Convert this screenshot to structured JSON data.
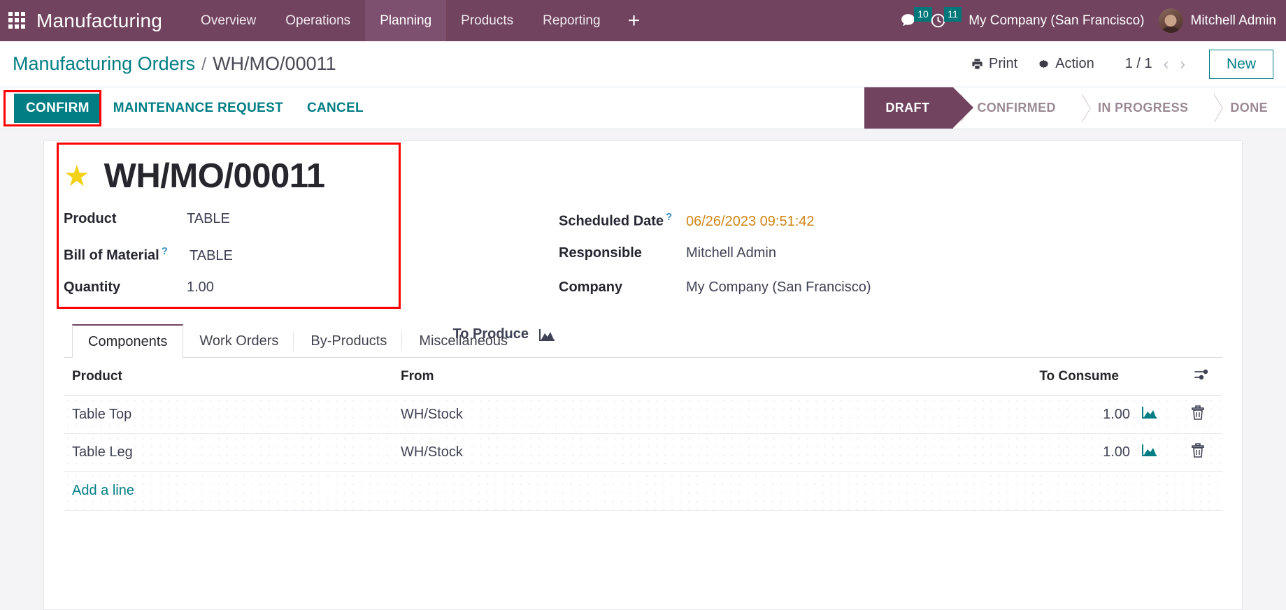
{
  "navbar": {
    "apps_icon": "apps-grid-icon",
    "app_title": "Manufacturing",
    "menu": [
      {
        "label": "Overview",
        "active": false
      },
      {
        "label": "Operations",
        "active": false
      },
      {
        "label": "Planning",
        "active": true
      },
      {
        "label": "Products",
        "active": false
      },
      {
        "label": "Reporting",
        "active": false
      }
    ],
    "plus_label": "+",
    "messages_badge": "10",
    "activities_badge": "11",
    "company": "My Company (San Francisco)",
    "user": "Mitchell Admin",
    "accent_bg": "#71435f",
    "badge_color": "#00787a"
  },
  "control_panel": {
    "breadcrumb_root": "Manufacturing Orders",
    "breadcrumb_separator": "/",
    "breadcrumb_current": "WH/MO/00011",
    "print_label": "Print",
    "action_label": "Action",
    "pager": "1 / 1",
    "prev_arrow": "‹",
    "next_arrow": "›",
    "new_label": "New",
    "accent_color": "#017e84"
  },
  "status_bar": {
    "buttons": [
      {
        "label": "CONFIRM",
        "primary": true,
        "highlighted": true
      },
      {
        "label": "MAINTENANCE REQUEST",
        "primary": false,
        "highlighted": false
      },
      {
        "label": "CANCEL",
        "primary": false,
        "highlighted": false
      }
    ],
    "stages": [
      {
        "label": "DRAFT",
        "active": true
      },
      {
        "label": "CONFIRMED",
        "active": false
      },
      {
        "label": "IN PROGRESS",
        "active": false
      },
      {
        "label": "DONE",
        "active": false
      }
    ],
    "highlight_color": "#ff0000"
  },
  "record": {
    "star_glyph": "★",
    "title": "WH/MO/00011",
    "left_fields": [
      {
        "label": "Product",
        "tip": "",
        "value": "TABLE"
      },
      {
        "label": "Bill of Material",
        "tip": "?",
        "value": "TABLE"
      },
      {
        "label": "Quantity",
        "tip": "",
        "value": "1.00"
      }
    ],
    "right_fields": [
      {
        "label": "Scheduled Date",
        "tip": "?",
        "value": "06/26/2023 09:51:42",
        "warn": true
      },
      {
        "label": "Responsible",
        "tip": "",
        "value": "Mitchell Admin",
        "warn": false
      },
      {
        "label": "Company",
        "tip": "",
        "value": "My Company (San Francisco)",
        "warn": false
      }
    ],
    "to_produce_label": "To Produce",
    "to_produce_icon": "area-chart-icon"
  },
  "notebook": {
    "tabs": [
      {
        "label": "Components",
        "active": true
      },
      {
        "label": "Work Orders",
        "active": false
      },
      {
        "label": "By-Products",
        "active": false
      },
      {
        "label": "Miscellaneous",
        "active": false
      }
    ]
  },
  "lines_table": {
    "columns": [
      "Product",
      "From",
      "To Consume"
    ],
    "optional_icon": "sliders-icon",
    "rows": [
      {
        "product": "Table Top",
        "from": "WH/Stock",
        "to_consume": "1.00",
        "chart_icon": "area-chart-icon",
        "delete_icon": "trash-icon"
      },
      {
        "product": "Table Leg",
        "from": "WH/Stock",
        "to_consume": "1.00",
        "chart_icon": "area-chart-icon",
        "delete_icon": "trash-icon"
      }
    ],
    "add_line_label": "Add a line"
  }
}
